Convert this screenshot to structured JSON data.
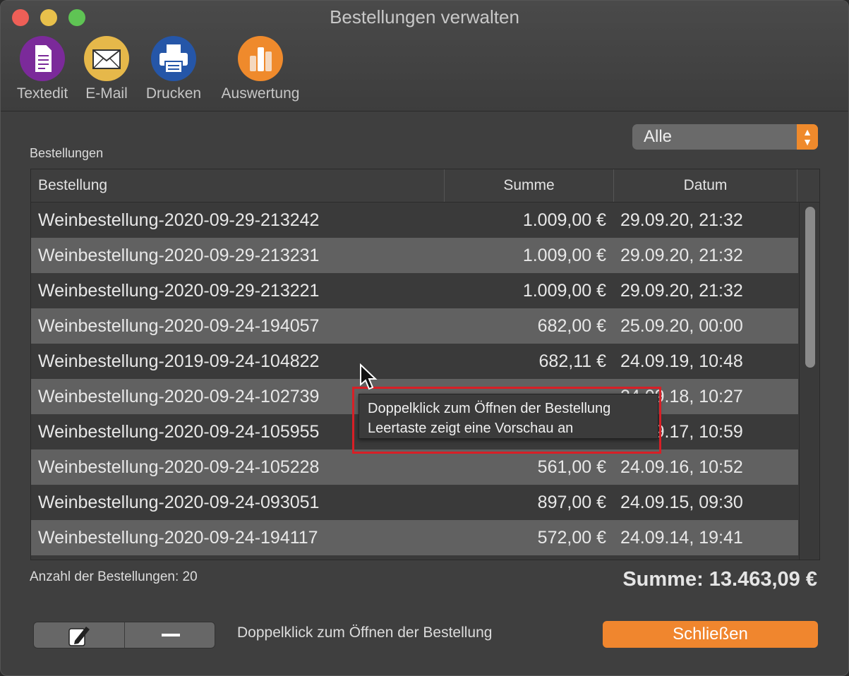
{
  "window": {
    "title": "Bestellungen verwalten"
  },
  "toolbar": {
    "textedit": {
      "label": "Textedit",
      "icon": "document-icon"
    },
    "email": {
      "label": "E-Mail",
      "icon": "envelope-icon"
    },
    "print": {
      "label": "Drucken",
      "icon": "printer-icon"
    },
    "report": {
      "label": "Auswertung",
      "icon": "bar-chart-icon"
    }
  },
  "section_label": "Bestellungen",
  "filter": {
    "selected": "Alle"
  },
  "table": {
    "headers": {
      "order": "Bestellung",
      "sum": "Summe",
      "date": "Datum"
    },
    "rows": [
      {
        "order": "Weinbestellung-2020-09-29-213242",
        "sum": "1.009,00 €",
        "date": "29.09.20, 21:32"
      },
      {
        "order": "Weinbestellung-2020-09-29-213231",
        "sum": "1.009,00 €",
        "date": "29.09.20, 21:32"
      },
      {
        "order": "Weinbestellung-2020-09-29-213221",
        "sum": "1.009,00 €",
        "date": "29.09.20, 21:32"
      },
      {
        "order": "Weinbestellung-2020-09-24-194057",
        "sum": "682,00 €",
        "date": "25.09.20, 00:00"
      },
      {
        "order": "Weinbestellung-2019-09-24-104822",
        "sum": "682,11 €",
        "date": "24.09.19, 10:48"
      },
      {
        "order": "Weinbestellung-2020-09-24-102739",
        "sum": "",
        "date": "24.09.18, 10:27"
      },
      {
        "order": "Weinbestellung-2020-09-24-105955",
        "sum": "",
        "date": "24.09.17, 10:59"
      },
      {
        "order": "Weinbestellung-2020-09-24-105228",
        "sum": "561,00 €",
        "date": "24.09.16, 10:52"
      },
      {
        "order": "Weinbestellung-2020-09-24-093051",
        "sum": "897,00 €",
        "date": "24.09.15, 09:30"
      },
      {
        "order": "Weinbestellung-2020-09-24-194117",
        "sum": "572,00 €",
        "date": "24.09.14, 19:41"
      }
    ]
  },
  "tooltip": {
    "line1": "Doppelklick zum Öffnen der Bestellung",
    "line2": "Leertaste zeigt eine Vorschau an"
  },
  "footer": {
    "count": "Anzahl der Bestellungen: 20",
    "total": "Summe: 13.463,09 €",
    "hint": "Doppelklick zum Öffnen der Bestellung",
    "close_label": "Schließen",
    "edit_icon": "edit-icon",
    "remove_icon": "minus-icon"
  }
}
